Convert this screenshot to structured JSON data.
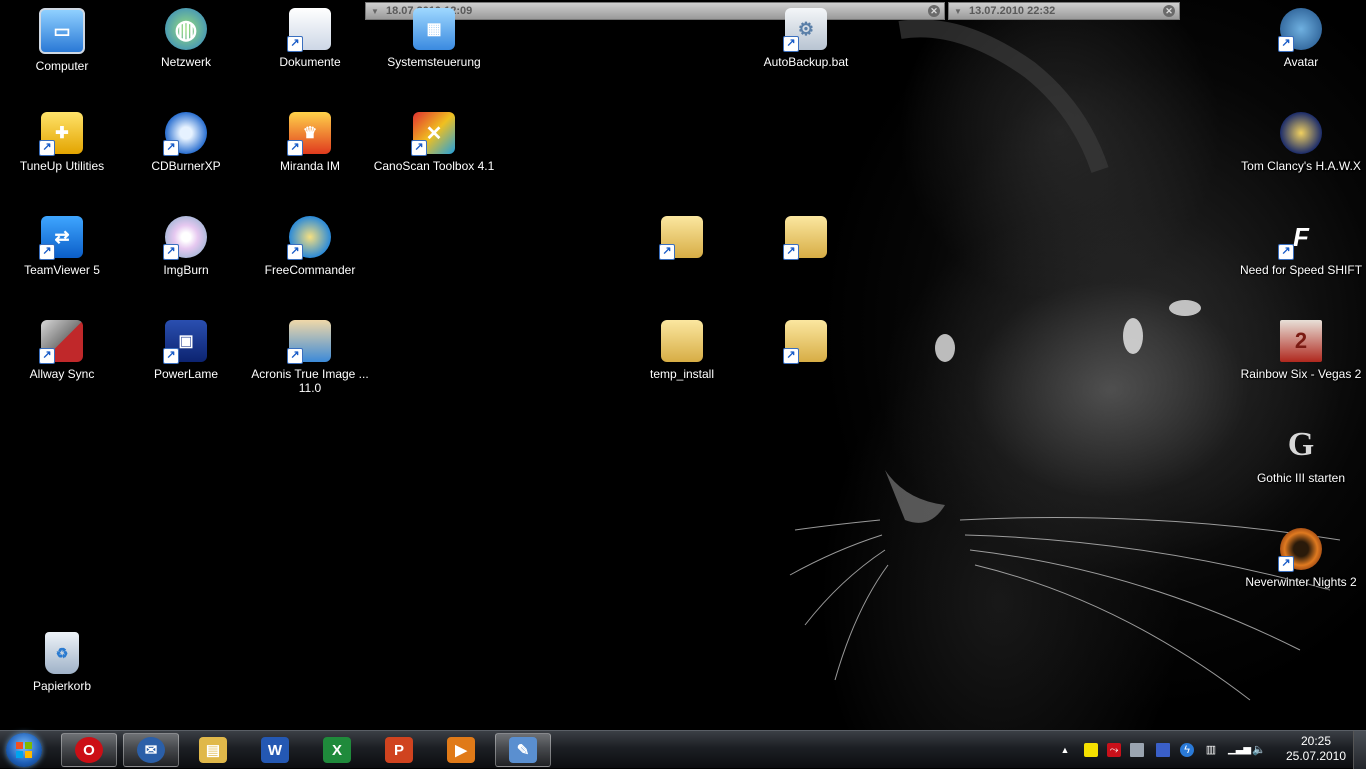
{
  "desktop": {
    "icons": [
      {
        "label": "Computer",
        "icon": "computer-icon"
      },
      {
        "label": "Netzwerk",
        "icon": "network-icon"
      },
      {
        "label": "Dokumente",
        "icon": "documents-icon"
      },
      {
        "label": "Systemsteuerung",
        "icon": "control-panel-icon"
      },
      {
        "label": "AutoBackup.bat",
        "icon": "batch-file-icon"
      },
      {
        "label": "Avatar",
        "icon": "avatar-game-icon"
      },
      {
        "label": "TuneUp Utilities",
        "icon": "tuneup-icon"
      },
      {
        "label": "CDBurnerXP",
        "icon": "cdburner-icon"
      },
      {
        "label": "Miranda IM",
        "icon": "miranda-icon"
      },
      {
        "label": "CanoScan Toolbox 4.1",
        "icon": "canoscan-icon"
      },
      {
        "label": "Tom Clancy's H.A.W.X",
        "icon": "hawx-icon"
      },
      {
        "label": "TeamViewer 5",
        "icon": "teamviewer-icon"
      },
      {
        "label": "ImgBurn",
        "icon": "imgburn-icon"
      },
      {
        "label": "FreeCommander",
        "icon": "freecommander-icon"
      },
      {
        "label": "",
        "icon": "folder-shortcut-icon"
      },
      {
        "label": "",
        "icon": "folder-shortcut-icon"
      },
      {
        "label": "Need for Speed SHIFT",
        "icon": "nfs-shift-icon"
      },
      {
        "label": "Allway Sync",
        "icon": "allway-sync-icon"
      },
      {
        "label": "PowerLame",
        "icon": "powerlame-icon"
      },
      {
        "label": "Acronis True Image ...",
        "label2": "11.0",
        "icon": "acronis-icon"
      },
      {
        "label": "temp_install",
        "icon": "folder-icon"
      },
      {
        "label": "",
        "icon": "folder-shortcut-icon"
      },
      {
        "label": "Rainbow Six - Vegas 2",
        "icon": "vegas2-icon"
      },
      {
        "label": "Gothic III starten",
        "icon": "gothic3-icon"
      },
      {
        "label": "Neverwinter Nights 2",
        "icon": "nwn2-icon"
      },
      {
        "label": "Papierkorb",
        "icon": "recycle-bin-icon"
      }
    ]
  },
  "gadgets": [
    {
      "text": "18.07.2010 12:09"
    },
    {
      "text": "13.07.2010 22:32"
    }
  ],
  "taskbar": {
    "start_icon": "windows-start-icon",
    "pinned": [
      {
        "name": "opera",
        "icon": "opera-icon",
        "glyph": "O",
        "color": "#cc0f16",
        "active": true
      },
      {
        "name": "thunderbird",
        "icon": "thunderbird-icon",
        "glyph": "✉",
        "color": "#2b5fa8",
        "active": true
      },
      {
        "name": "explorer",
        "icon": "folder-icon",
        "glyph": "▤",
        "color": "#e0b84a",
        "active": false
      },
      {
        "name": "word",
        "icon": "word-icon",
        "glyph": "W",
        "color": "#2458b3",
        "active": false
      },
      {
        "name": "excel",
        "icon": "excel-icon",
        "glyph": "X",
        "color": "#1f8a3b",
        "active": false
      },
      {
        "name": "powerpoint",
        "icon": "powerpoint-icon",
        "glyph": "P",
        "color": "#d0431f",
        "active": false
      },
      {
        "name": "media-player",
        "icon": "media-player-icon",
        "glyph": "▶",
        "color": "#e07a18",
        "active": false
      },
      {
        "name": "paint",
        "icon": "paint-icon",
        "glyph": "✎",
        "color": "#5a8fd0",
        "active": true
      }
    ],
    "tray_icons": [
      "show-hidden-icon",
      "notes-icon",
      "antivirus-icon",
      "network-monitor-icon",
      "taskmanager-icon",
      "power-icon",
      "clipboard-icon",
      "signal-icon",
      "volume-icon"
    ],
    "clock_time": "20:25",
    "clock_date": "25.07.2010"
  }
}
